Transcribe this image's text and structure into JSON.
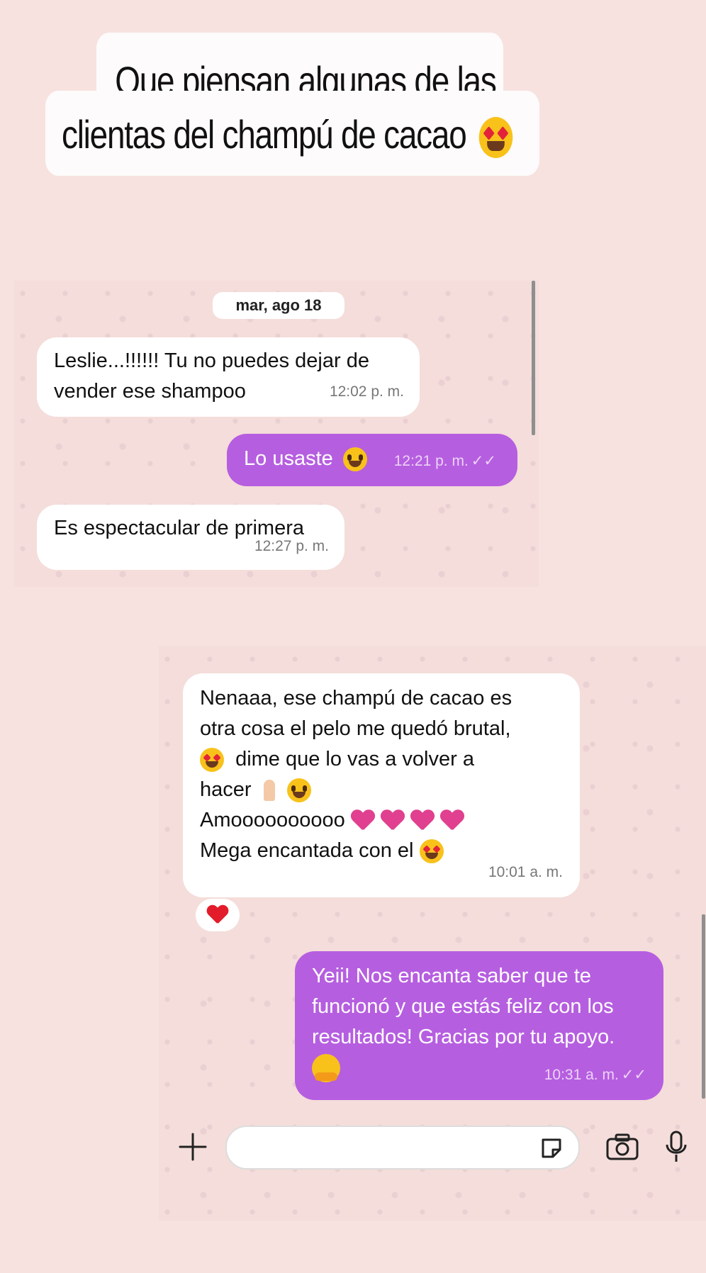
{
  "caption": {
    "line1": "Que piensan algunas de las",
    "line2": "clientas del champú de cacao"
  },
  "chat1": {
    "date": "mar, ago 18",
    "messages": [
      {
        "dir": "in",
        "text_line1": "Leslie...!!!!!! Tu no puedes dejar de",
        "text_line2": "vender ese shampoo",
        "time": "12:02 p. m."
      },
      {
        "dir": "out",
        "text": "Lo usaste",
        "time": "12:21 p. m.",
        "ticks": "✓✓"
      },
      {
        "dir": "in",
        "text": "Es espectacular de primera",
        "time": "12:27 p. m."
      }
    ]
  },
  "chat2": {
    "messages": [
      {
        "dir": "in",
        "line1": "Nenaaa, ese champú de cacao es",
        "line2": "otra cosa el pelo me quedó brutal,",
        "line3": "dime que lo vas a volver a",
        "line4": "hacer",
        "line5": "Amoooooooooo",
        "line6": "Mega encantada con el",
        "time": "10:01 a. m.",
        "reaction": "red-heart"
      },
      {
        "dir": "out",
        "line1": "Yeii! Nos encanta saber que te",
        "line2": "funcionó y que estás feliz con los",
        "line3": "resultados! Gracias por tu apoyo.",
        "time": "10:31 a. m.",
        "ticks": "✓✓"
      }
    ],
    "input": {
      "placeholder": "",
      "icons": [
        "plus-icon",
        "sticker-icon",
        "camera-icon",
        "microphone-icon"
      ]
    }
  },
  "colors": {
    "outgoing_bubble": "#b65ee0",
    "incoming_bubble": "#ffffff",
    "background": "#f7e2e0"
  }
}
